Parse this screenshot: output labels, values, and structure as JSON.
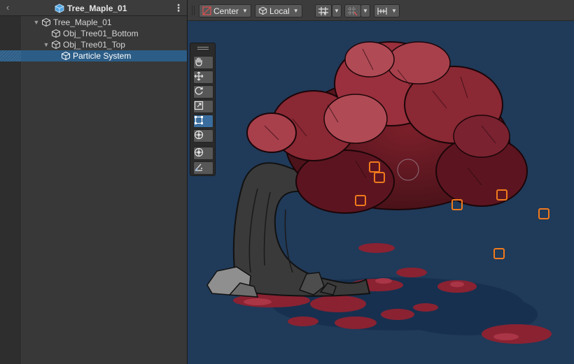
{
  "hierarchy": {
    "scene_title": "Tree_Maple_01",
    "items": [
      {
        "label": "Tree_Maple_01",
        "expanded": true
      },
      {
        "label": "Obj_Tree01_Bottom"
      },
      {
        "label": "Obj_Tree01_Top",
        "expanded": true
      },
      {
        "label": "Particle System",
        "selected": true
      }
    ]
  },
  "scene_toolbar": {
    "pivot_label": "Center",
    "space_label": "Local"
  },
  "tools": [
    "view-tool",
    "move-tool",
    "rotate-tool",
    "scale-tool",
    "rect-tool",
    "transform-tool",
    "custom-tool",
    "particle-tool"
  ],
  "active_tool": "rect-tool",
  "colors": {
    "viewport_bg": "#203a59",
    "selection": "#2c5d87",
    "gizmo": "#f07a1c",
    "foliage": "#8e2a34"
  }
}
